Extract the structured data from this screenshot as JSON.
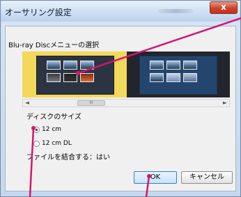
{
  "window": {
    "title": "オーサリング設定",
    "close_label": "x"
  },
  "dialog": {
    "menu_section_label": "Blu-ray Discメニューの選択",
    "scroll_thumb_grip": "III",
    "scroll_left": "◄",
    "scroll_right": "►",
    "disc_size_label": "ディスクのサイズ",
    "options": [
      {
        "label": "12 cm",
        "selected": true
      },
      {
        "label": "12 cm DL",
        "selected": false
      }
    ],
    "combine_files": "ファイルを結合する：はい",
    "ok_label": "OK",
    "cancel_label": "キャンセル"
  },
  "colors": {
    "selected_menu_highlight": "#f2d85b",
    "callout_line": "#d4166e"
  },
  "icons": [
    "close-icon",
    "scroll-left-icon",
    "scroll-right-icon",
    "radio-icon"
  ]
}
